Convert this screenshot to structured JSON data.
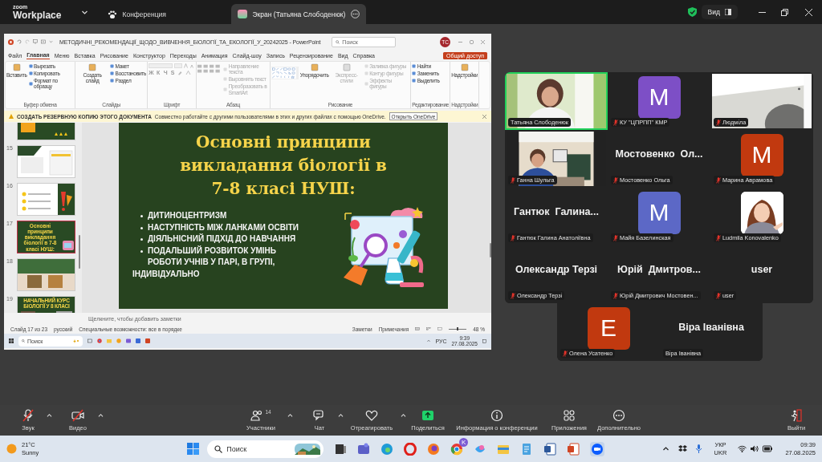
{
  "app": {
    "logo_small": "zoom",
    "logo_large": "Workplace"
  },
  "top_bar": {
    "tabs": [
      {
        "label": "Конференция",
        "kind": "meeting",
        "selected": false
      },
      {
        "label": "Экран (Татьяна Слободенюк)",
        "kind": "share",
        "selected": true
      }
    ],
    "view_button": "Вид"
  },
  "shared_screen": {
    "title": "МЕТОДИЧНІ_РЕКОМЕНДАЦІЇ_ЩОДО_ВИВЧЕННЯ_БІОЛОГІЇ_ТА_ЕКОЛОГІЇ_У_20242025  -  PowerPoint",
    "search_placeholder": "Поиск",
    "user_initials": "ТС",
    "ribbon_tabs": [
      {
        "label": "Файл",
        "selected": false
      },
      {
        "label": "Главная",
        "selected": true
      },
      {
        "label": "Меню",
        "selected": false
      },
      {
        "label": "Вставка",
        "selected": false
      },
      {
        "label": "Рисование",
        "selected": false
      },
      {
        "label": "Конструктор",
        "selected": false
      },
      {
        "label": "Переходы",
        "selected": false
      },
      {
        "label": "Анимация",
        "selected": false
      },
      {
        "label": "Слайд-шоу",
        "selected": false
      },
      {
        "label": "Запись",
        "selected": false
      },
      {
        "label": "Рецензирование",
        "selected": false
      },
      {
        "label": "Вид",
        "selected": false
      },
      {
        "label": "Справка",
        "selected": false
      }
    ],
    "share_button": "Общий доступ",
    "ribbon_groups": [
      {
        "label": "Буфер обмена",
        "commands": [
          {
            "label": "Вставить",
            "kind": "large",
            "disabled": false
          },
          {
            "label": "Вырезать",
            "kind": "small",
            "disabled": false
          },
          {
            "label": "Копировать",
            "kind": "small",
            "disabled": false
          },
          {
            "label": "Формат по образцу",
            "kind": "small",
            "disabled": false
          }
        ]
      },
      {
        "label": "Слайды",
        "commands": [
          {
            "label": "Создать слайд",
            "kind": "large",
            "disabled": false
          },
          {
            "label": "Макет",
            "kind": "small",
            "disabled": false
          },
          {
            "label": "Восстановить",
            "kind": "small",
            "disabled": false
          },
          {
            "label": "Раздел",
            "kind": "small",
            "disabled": false
          }
        ]
      },
      {
        "label": "Шрифт",
        "kind": "font",
        "buttons": [
          "Ж",
          "К",
          "Ч",
          "S"
        ]
      },
      {
        "label": "Абзац",
        "kind": "paragraph",
        "commands": [
          {
            "label": "Направление текста",
            "kind": "small",
            "disabled": true
          },
          {
            "label": "Выровнять текст",
            "kind": "small",
            "disabled": true
          },
          {
            "label": "Преобразовать в SmartArt",
            "kind": "small",
            "disabled": true
          }
        ]
      },
      {
        "label": "Рисование",
        "kind": "shapes",
        "commands": [
          {
            "label": "Упорядочить",
            "kind": "large",
            "disabled": false
          },
          {
            "label": "Экспресс-стили",
            "kind": "large",
            "disabled": true
          },
          {
            "label": "Заливка фигуры",
            "kind": "small",
            "disabled": true
          },
          {
            "label": "Контур фигуры",
            "kind": "small",
            "disabled": true
          },
          {
            "label": "Эффекты фигуры",
            "kind": "small",
            "disabled": true
          }
        ]
      },
      {
        "label": "Редактирование",
        "commands": [
          {
            "label": "Найти",
            "kind": "small",
            "disabled": false
          },
          {
            "label": "Заменить",
            "kind": "small",
            "disabled": false
          },
          {
            "label": "Выделить",
            "kind": "small",
            "disabled": false
          }
        ]
      },
      {
        "label": "Надстройки",
        "commands": [
          {
            "label": "Надстройки",
            "kind": "large",
            "disabled": false
          }
        ]
      }
    ],
    "notification": {
      "title": "СОЗДАТЬ РЕЗЕРВНУЮ КОПИЮ ЭТОГО ДОКУМЕНТА",
      "message": "Совместно работайте с другими пользователями в этих и других файлах с помощью OneDrive.",
      "button": "Открыть OneDrive"
    },
    "thumbnails": [
      {
        "kind": "stars",
        "selected": false
      },
      {
        "number": "15",
        "kind": "table",
        "selected": false
      },
      {
        "number": "16",
        "kind": "list",
        "selected": false
      },
      {
        "number": "17",
        "kind": "title",
        "title": "Основні принципи викладання біології в 7-8 класі НУШ:",
        "selected": true
      },
      {
        "number": "18",
        "selected": false
      },
      {
        "number": "19",
        "kind": "title-photo",
        "title": "НАЧАЛЬНИЙ КУРС БІОЛОГІЇ У 8 КЛАСІ",
        "selected": false
      }
    ],
    "slide": {
      "title": "Основні принципи\nвикладання біології в\n7-8 класі НУШ:",
      "bullets": [
        "ДИТИНОЦЕНТРИЗМ",
        "НАСТУПНІСТЬ МІЖ ЛАНКАМИ ОСВІТИ",
        "ДІЯЛЬНІСНИЙ ПІДХІД ДО НАВЧАННЯ",
        "ПОДАЛЬШИЙ РОЗВИТОК УМІНЬ\nРОБОТИ УЧНІВ У ПАРІ, В ГРУПІ,"
      ],
      "closing": "ІНДИВІДУАЛЬНО"
    },
    "notes_placeholder": "Щелкните, чтобы добавить заметки",
    "status": {
      "slide": "Слайд 17 из 23",
      "language": "русский",
      "accessibility": "Специальные возможности: все в порядке",
      "notes": "Заметки",
      "comments": "Примечания",
      "zoom": "48 %",
      "level": 0.45
    },
    "inner_taskbar": {
      "search": "Поиск",
      "language": "РУС",
      "time": "9:39",
      "date": "27.08.2025"
    }
  },
  "gallery": {
    "tiles": [
      {
        "kind": "video",
        "label": "Татьяна Слободенюк",
        "muted": false,
        "speaking": true
      },
      {
        "kind": "avatar",
        "letter": "M",
        "color": "#7d4fc6",
        "label": "КУ \"ЦПРПП\" КМР",
        "muted": true,
        "speaking": false
      },
      {
        "kind": "video",
        "label": "Людміла",
        "muted": true,
        "speaking": false
      },
      {
        "kind": "video",
        "label": "Ганна Шульга",
        "muted": true,
        "speaking": false
      },
      {
        "kind": "name",
        "display_name": "Мостовенко  Ол...",
        "label": "Мостовенко Ольга",
        "muted": true,
        "speaking": false
      },
      {
        "kind": "avatar",
        "letter": "M",
        "color": "#c1390f",
        "label": "Марина Аврамова",
        "muted": true,
        "speaking": false
      },
      {
        "kind": "name",
        "display_name": "Гантюк  Галина...",
        "label": "Гантюк Галина Анатоліївна",
        "muted": true,
        "speaking": false
      },
      {
        "kind": "avatar",
        "letter": "M",
        "color": "#5c68c6",
        "label": "Майя Базелинская",
        "muted": true,
        "speaking": false
      },
      {
        "label": "Ludmila Konovalenko",
        "muted": true,
        "speaking": false
      },
      {
        "kind": "name",
        "display_name": "Олександр Терзі",
        "label": "Олександр Терзі",
        "muted": true,
        "speaking": false
      },
      {
        "kind": "name",
        "display_name": "Юрій  Дмитров...",
        "label": "Юрій Дмитрович Мостовен...",
        "muted": true,
        "speaking": false
      },
      {
        "kind": "name",
        "display_name": "user",
        "label": "user",
        "muted": true,
        "speaking": false
      },
      {
        "kind": "avatar",
        "letter": "E",
        "color": "#c1390f",
        "label": "Олена Усатенко",
        "muted": true,
        "speaking": false
      },
      {
        "kind": "name",
        "display_name": "Віра Іванівна",
        "label": "Віра Іванівна",
        "muted": false,
        "speaking": false
      }
    ]
  },
  "toolbar": {
    "items": [
      {
        "kind": "audio",
        "label": "Звук",
        "off": true,
        "menu": true
      },
      {
        "kind": "video",
        "label": "Видео",
        "off": true,
        "menu": true
      },
      {
        "kind": "participants",
        "label": "Участники",
        "count": "14",
        "menu": true
      },
      {
        "kind": "chat",
        "label": "Чат",
        "menu": true
      },
      {
        "kind": "react",
        "label": "Отреагировать",
        "menu": true
      },
      {
        "kind": "share",
        "label": "Поделиться",
        "menu": false
      },
      {
        "kind": "info",
        "label": "Информация о конференции",
        "menu": false
      },
      {
        "kind": "apps",
        "label": "Приложения",
        "menu": false
      },
      {
        "kind": "more",
        "label": "Дополнительно",
        "menu": false
      },
      {
        "kind": "leave",
        "label": "Выйти",
        "menu": false
      }
    ]
  },
  "taskbar": {
    "weather": {
      "temp": "21°C",
      "text": "Sunny"
    },
    "search": "Поиск",
    "profile_badge": "K",
    "language": "УКР",
    "layout": "UKR",
    "time": "09:39",
    "date": "27.08.2025"
  }
}
